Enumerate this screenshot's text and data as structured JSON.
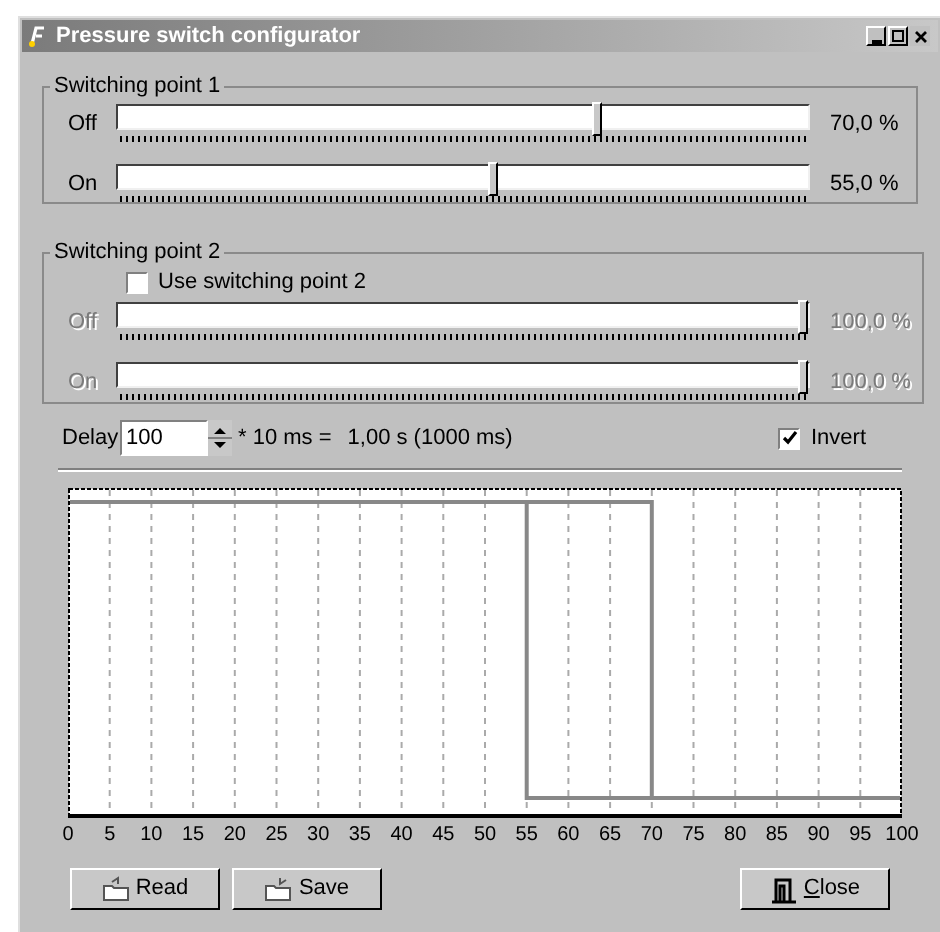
{
  "window": {
    "title": "Pressure switch configurator"
  },
  "switching_point_1": {
    "title": "Switching point 1",
    "sliders": [
      {
        "label": "Off",
        "level": 0.7,
        "reading": "70,0 %",
        "disabled": false
      },
      {
        "label": "On",
        "level": 0.55,
        "reading": "55,0 %",
        "disabled": false
      }
    ]
  },
  "switching_point_2": {
    "title": "Switching point 2",
    "use_checkbox": {
      "label": "Use switching point 2",
      "checked": false
    },
    "sliders": [
      {
        "label": "Off",
        "level": 1,
        "reading": "100,0 %",
        "disabled": true
      },
      {
        "label": "On",
        "level": 1,
        "reading": "100,0 %",
        "disabled": true
      }
    ]
  },
  "delay": {
    "label": "Delay",
    "value": "100",
    "formula": "* 10 ms =",
    "result": "1,00 s (1000 ms)"
  },
  "invert": {
    "label": "Invert",
    "checked": true
  },
  "chart": {
    "axis_labels": [
      "0",
      "5",
      "10",
      "15",
      "20",
      "25",
      "30",
      "35",
      "40",
      "45",
      "50",
      "55",
      "60",
      "65",
      "70",
      "75",
      "80",
      "85",
      "90",
      "95",
      "100"
    ]
  },
  "buttons": [
    {
      "label": "Read",
      "kind": "read",
      "mnemonic": false
    },
    {
      "label": "Save",
      "kind": "save",
      "mnemonic": false
    },
    {
      "label": "Close",
      "kind": "close",
      "mnemonic": true
    }
  ]
}
